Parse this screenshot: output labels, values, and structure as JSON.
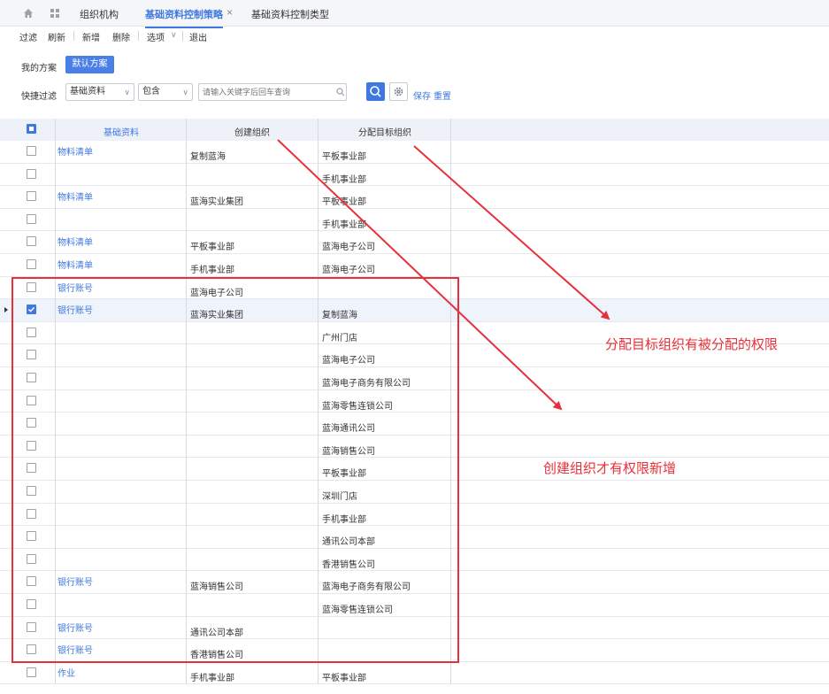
{
  "topbar": {
    "tabs": [
      {
        "label": "组织机构",
        "active": false
      },
      {
        "label": "基础资料控制策略",
        "active": true
      },
      {
        "label": "基础资料控制类型",
        "active": false
      }
    ],
    "close_glyph": "×"
  },
  "toolbar": {
    "items": [
      "过滤",
      "刷新",
      "新增",
      "删除",
      "选项",
      "退出"
    ],
    "options_chevron": "∨"
  },
  "schemes": {
    "label": "我的方案",
    "default_button": "默认方案"
  },
  "quick_filter": {
    "label": "快捷过滤",
    "field_value": "基础资料",
    "operator_value": "包含",
    "chevron": "∨",
    "search_placeholder": "请输入关键字后回车查询",
    "save_label": "保存",
    "reset_label": "重置"
  },
  "table": {
    "headers": [
      "基础资料",
      "创建组织",
      "分配目标组织"
    ],
    "rows": [
      {
        "base": "物料清单",
        "create_org": "复制蓝海",
        "target_org": "平板事业部",
        "checked": false
      },
      {
        "base": "",
        "create_org": "",
        "target_org": "手机事业部",
        "checked": false
      },
      {
        "base": "物料清单",
        "create_org": "蓝海实业集团",
        "target_org": "平板事业部",
        "checked": false
      },
      {
        "base": "",
        "create_org": "",
        "target_org": "手机事业部",
        "checked": false
      },
      {
        "base": "物料清单",
        "create_org": "平板事业部",
        "target_org": "蓝海电子公司",
        "checked": false
      },
      {
        "base": "物料清单",
        "create_org": "手机事业部",
        "target_org": "蓝海电子公司",
        "checked": false
      },
      {
        "base": "银行账号",
        "create_org": "蓝海电子公司",
        "target_org": "",
        "checked": false
      },
      {
        "base": "银行账号",
        "create_org": "蓝海实业集团",
        "target_org": "复制蓝海",
        "checked": true
      },
      {
        "base": "",
        "create_org": "",
        "target_org": "广州门店",
        "checked": false
      },
      {
        "base": "",
        "create_org": "",
        "target_org": "蓝海电子公司",
        "checked": false
      },
      {
        "base": "",
        "create_org": "",
        "target_org": "蓝海电子商务有限公司",
        "checked": false
      },
      {
        "base": "",
        "create_org": "",
        "target_org": "蓝海零售连锁公司",
        "checked": false
      },
      {
        "base": "",
        "create_org": "",
        "target_org": "蓝海通讯公司",
        "checked": false
      },
      {
        "base": "",
        "create_org": "",
        "target_org": "蓝海销售公司",
        "checked": false
      },
      {
        "base": "",
        "create_org": "",
        "target_org": "平板事业部",
        "checked": false
      },
      {
        "base": "",
        "create_org": "",
        "target_org": "深圳门店",
        "checked": false
      },
      {
        "base": "",
        "create_org": "",
        "target_org": "手机事业部",
        "checked": false
      },
      {
        "base": "",
        "create_org": "",
        "target_org": "通讯公司本部",
        "checked": false
      },
      {
        "base": "",
        "create_org": "",
        "target_org": "香港销售公司",
        "checked": false
      },
      {
        "base": "银行账号",
        "create_org": "蓝海销售公司",
        "target_org": "蓝海电子商务有限公司",
        "checked": false
      },
      {
        "base": "",
        "create_org": "",
        "target_org": "蓝海零售连锁公司",
        "checked": false
      },
      {
        "base": "银行账号",
        "create_org": "通讯公司本部",
        "target_org": "",
        "checked": false
      },
      {
        "base": "银行账号",
        "create_org": "香港销售公司",
        "target_org": "",
        "checked": false
      },
      {
        "base": "作业",
        "create_org": "手机事业部",
        "target_org": "平板事业部",
        "checked": false
      }
    ]
  },
  "annotations": {
    "target_org_note": "分配目标组织有被分配的权限",
    "create_org_note": "创建组织才有权限新增"
  },
  "colors": {
    "accent": "#3f78e0",
    "annotation_red": "#e8303a",
    "header_bg": "#eef2f8"
  },
  "icons": [
    "home-icon",
    "apps-grid-icon",
    "search-icon",
    "gear-icon",
    "chevron-down-icon",
    "close-icon"
  ]
}
